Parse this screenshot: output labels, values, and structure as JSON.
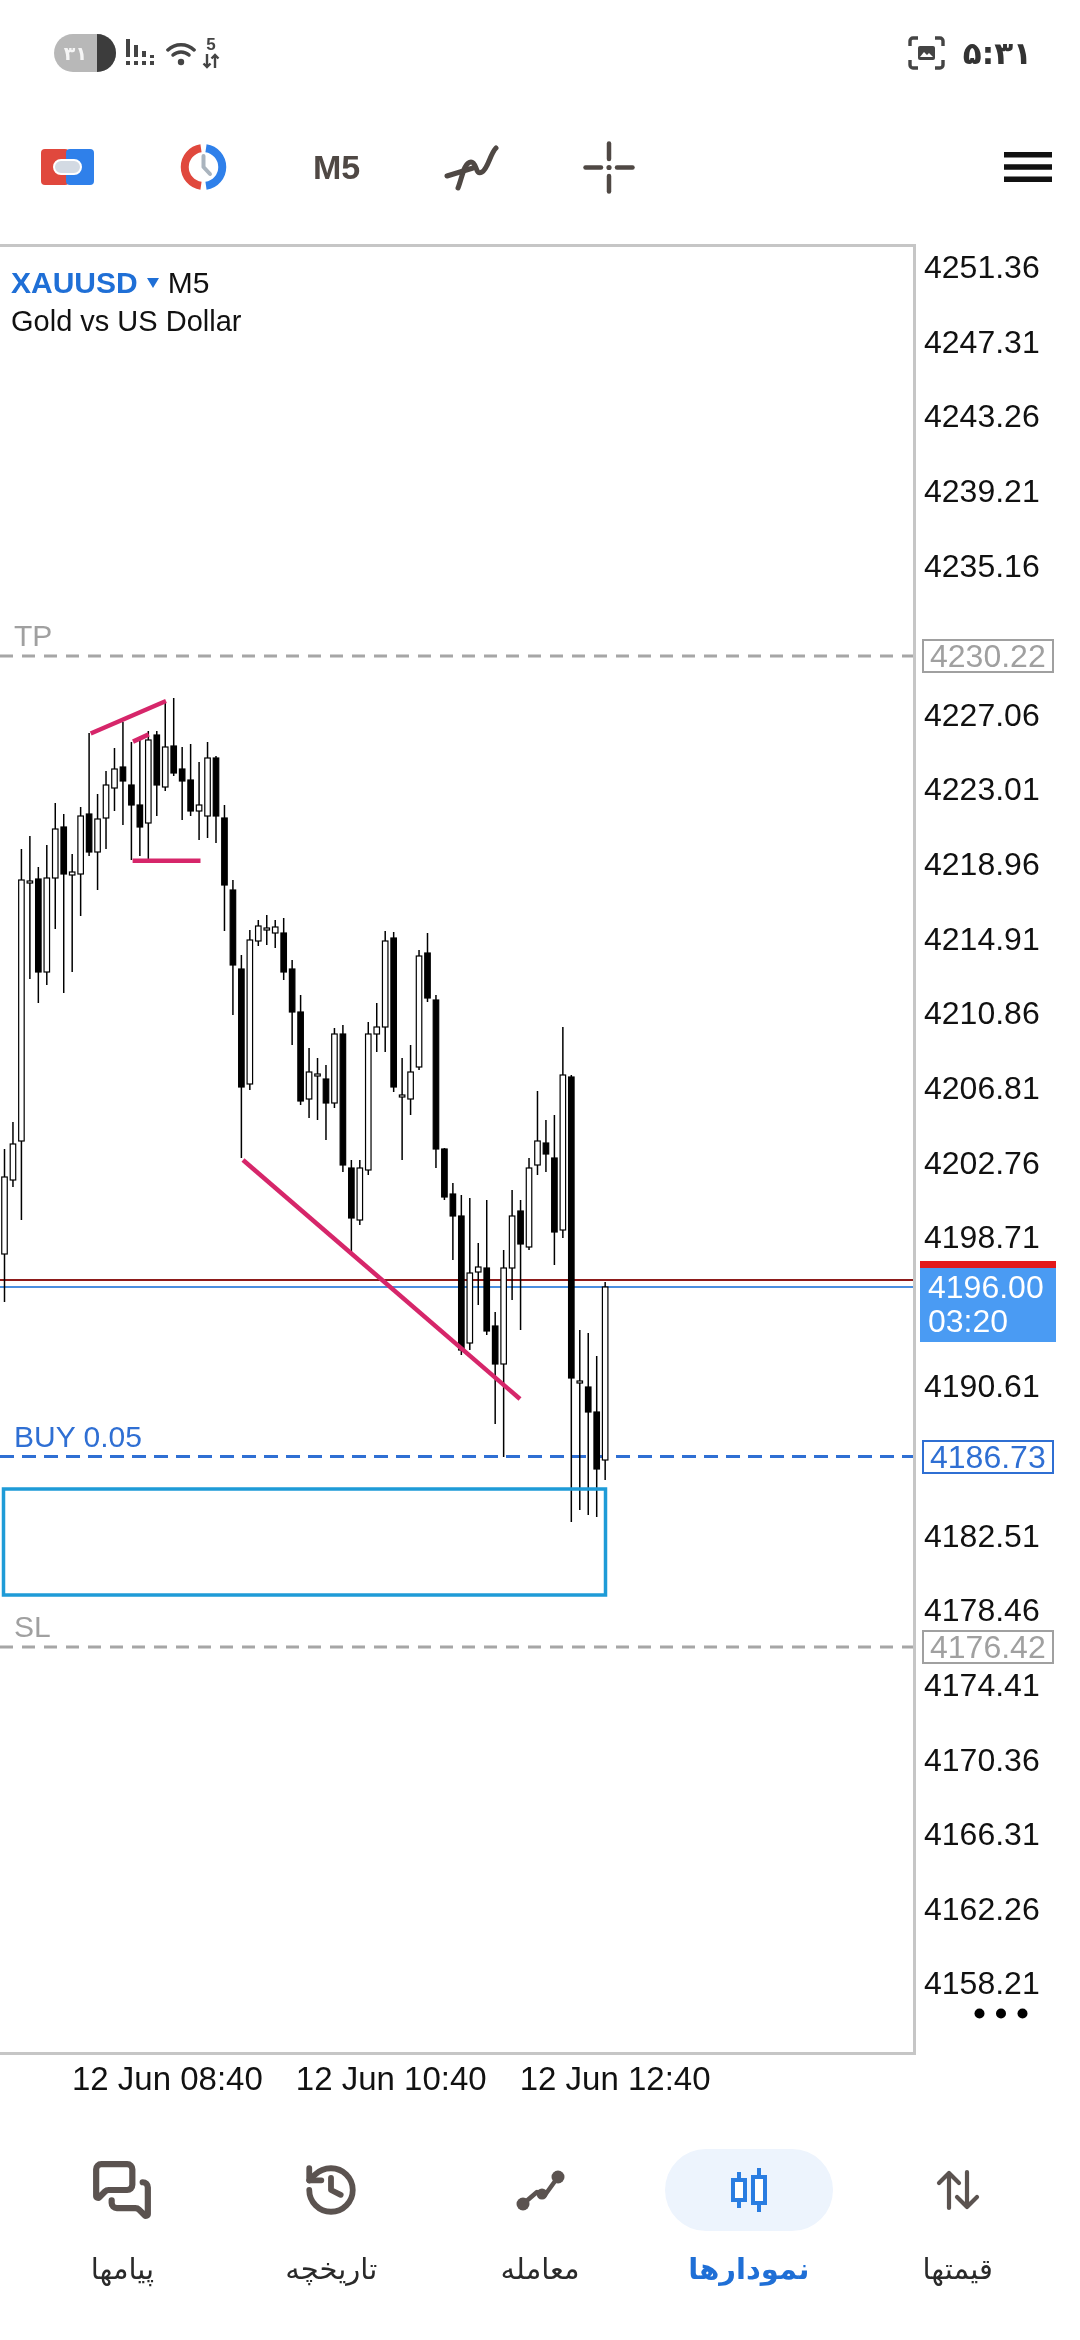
{
  "status_bar": {
    "battery": {
      "label": "۳۱",
      "level": 0.31
    },
    "wifi_label": "5",
    "time": "۵:۳۱"
  },
  "toolbar": {
    "timeframe": "M5"
  },
  "chart": {
    "symbol": "XAUUSD",
    "timeframe": "M5",
    "description": "Gold vs US Dollar",
    "price_axis": [
      "4251.36",
      "4247.31",
      "4243.26",
      "4239.21",
      "4235.16",
      "4227.06",
      "4223.01",
      "4218.96",
      "4214.91",
      "4210.86",
      "4206.81",
      "4202.76",
      "4198.71",
      "4190.61",
      "4182.51",
      "4178.46",
      "4174.41",
      "4170.36",
      "4166.31",
      "4162.26",
      "4158.21"
    ],
    "levels": [
      {
        "kind": "take_profit",
        "label": "TP",
        "price": "4230.22"
      },
      {
        "kind": "order",
        "label": "BUY 0.05",
        "price": "4186.73"
      },
      {
        "kind": "stop_loss",
        "label": "SL",
        "price": "4176.42"
      }
    ],
    "current_price": {
      "price": "4196.00",
      "countdown": "03:20"
    },
    "time_axis": [
      "12 Jun 08:40",
      "12 Jun 10:40",
      "12 Jun 12:40"
    ]
  },
  "bottom_nav": [
    {
      "label": "قیمتها",
      "selected": false
    },
    {
      "label": "نمودارها",
      "selected": true
    },
    {
      "label": "معامله",
      "selected": false
    },
    {
      "label": "تاریخچه",
      "selected": false
    },
    {
      "label": "پیامها",
      "selected": false
    }
  ]
}
